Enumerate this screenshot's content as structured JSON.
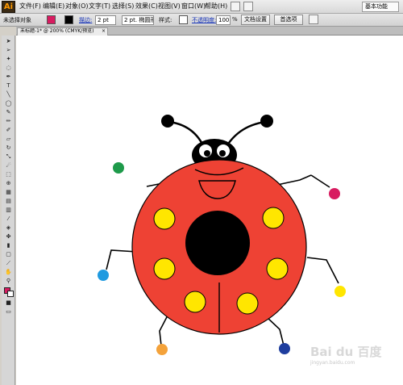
{
  "app": {
    "logo": "Ai"
  },
  "menubar": {
    "items": [
      "文件(F)",
      "编辑(E)",
      "对象(O)",
      "文字(T)",
      "选择(S)",
      "效果(C)",
      "视图(V)",
      "窗口(W)",
      "帮助(H)"
    ],
    "workspace": "基本功能"
  },
  "control": {
    "selection_label": "未选择对象",
    "stroke_label": "描边:",
    "stroke_weight": "2 pt",
    "brush": "2 pt. 椭圆形",
    "style_label": "样式:",
    "opacity_label": "不透明度:",
    "opacity_value": "100",
    "opacity_unit": "%",
    "doc_setup": "文档设置",
    "preferences": "首选项"
  },
  "tab": {
    "title": "未标题-1* @ 200% (CMYK/预览)",
    "close": "×"
  },
  "colors": {
    "fill": "#d81b60",
    "stroke": "#000000",
    "body": "#ee4234",
    "spot": "#ffe600",
    "dark": "#000000",
    "foot_green": "#1e9a4a",
    "foot_magenta": "#d81b60",
    "foot_blue": "#1f9ae0",
    "foot_yellow": "#ffe600",
    "foot_orange": "#f4a23a",
    "foot_navy": "#1e3d9e"
  },
  "watermark": {
    "main": "Bai du 百度",
    "sub": "jingyan.baidu.com"
  }
}
